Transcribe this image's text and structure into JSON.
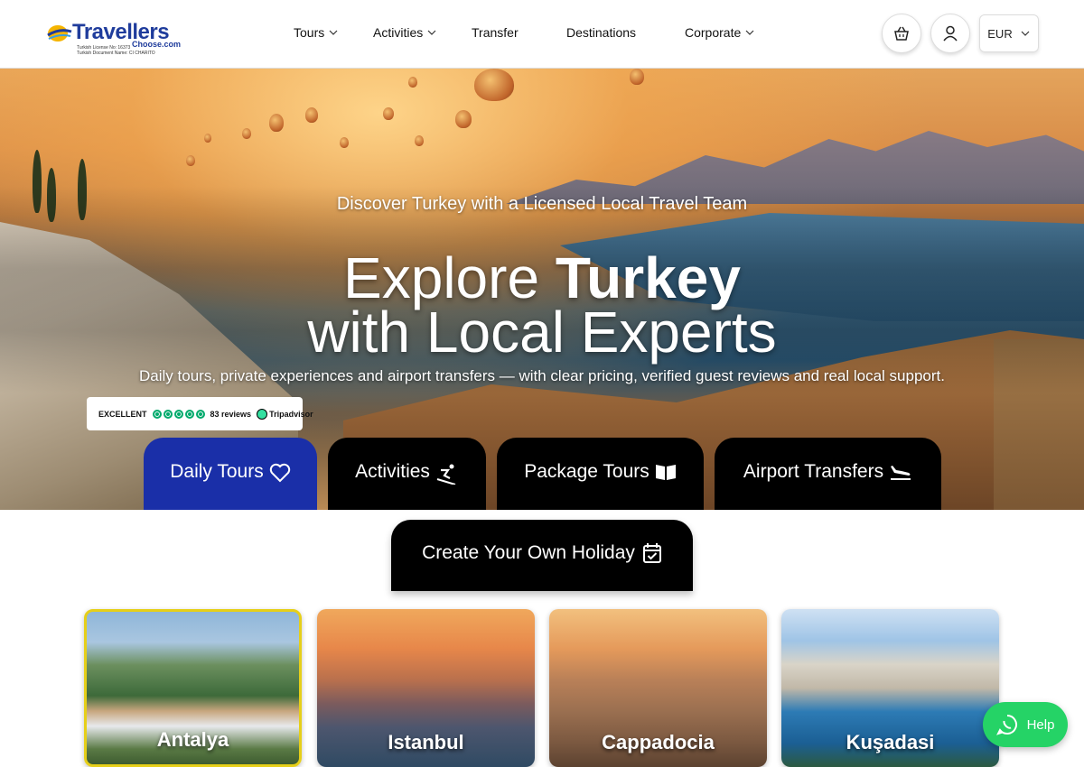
{
  "brand": {
    "logo_text": "Travellers",
    "logo_sub": "Choose.com",
    "license_line1": "Turkish License No: 16373",
    "license_line2": "Turkish Document Name: CI CHARITO"
  },
  "nav": {
    "items": [
      {
        "label": "Tours",
        "has_dropdown": true
      },
      {
        "label": "Activities",
        "has_dropdown": true
      },
      {
        "label": "Transfer",
        "has_dropdown": false
      },
      {
        "label": "Destinations",
        "has_dropdown": false
      },
      {
        "label": "Corporate",
        "has_dropdown": true
      }
    ],
    "currency": "EUR"
  },
  "hero": {
    "kicker": "Discover Turkey with a Licensed Local Travel Team",
    "title_line1_light": "Explore ",
    "title_line1_bold": "Turkey",
    "title_line2": "with Local Experts",
    "subtitle": "Daily tours, private experiences and airport transfers — with clear pricing, verified guest reviews and real local support."
  },
  "tripadvisor": {
    "rating_word": "EXCELLENT",
    "stars": 5,
    "reviews": "83 reviews",
    "brand": "Tripadvisor"
  },
  "tabs": [
    {
      "label": "Daily Tours",
      "icon": "heart-icon",
      "active": true
    },
    {
      "label": "Activities",
      "icon": "skiing-icon",
      "active": false
    },
    {
      "label": "Package Tours",
      "icon": "book-open-icon",
      "active": false
    },
    {
      "label": "Airport Transfers",
      "icon": "plane-landing-icon",
      "active": false
    }
  ],
  "holiday_button": {
    "label": "Create Your Own Holiday",
    "icon": "calendar-check-icon"
  },
  "destinations": [
    {
      "label": "Antalya",
      "selected": true
    },
    {
      "label": "Istanbul",
      "selected": false
    },
    {
      "label": "Cappadocia",
      "selected": false
    },
    {
      "label": "Kuşadasi",
      "selected": false
    }
  ],
  "help_button": {
    "label": "Help",
    "icon": "whatsapp-icon"
  },
  "colors": {
    "brand_blue": "#1f3c9c",
    "active_tab": "#1a2fa8",
    "tab_black": "#000000",
    "whatsapp_green": "#25d366",
    "selected_border": "#e6cf19",
    "tripadvisor_green": "#00aa6c"
  }
}
